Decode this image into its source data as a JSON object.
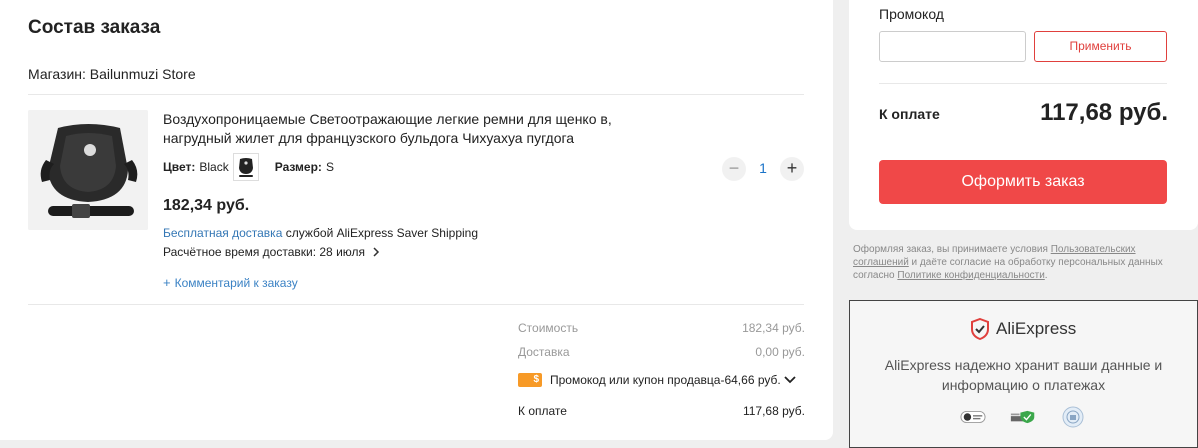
{
  "order": {
    "title": "Состав заказа",
    "store": "Магазин: Bailunmuzi Store",
    "product": {
      "title": "Воздухопроницаемые Светоотражающие легкие ремни для щенко в, нагрудный жилет для французского бульдога Чихуахуа пугдога",
      "color_label": "Цвет:",
      "color_value": "Black",
      "size_label": "Размер:",
      "size_value": "S",
      "quantity": "1",
      "price": "182,34 руб.",
      "shipping_link": "Бесплатная доставка",
      "shipping_text": "службой AliExpress Saver Shipping",
      "eta": "Расчётное время доставки: 28 июля",
      "comment": "Комментарий к заказу"
    },
    "summary": {
      "cost_label": "Стоимость",
      "cost_value": "182,34 руб.",
      "delivery_label": "Доставка",
      "delivery_value": "0,00 руб.",
      "coupon_text": "Промокод или купон продавца-64,66 руб.",
      "total_label": "К оплате",
      "total_value": "117,68 руб."
    }
  },
  "side": {
    "promo_label": "Промокод",
    "promo_value": "",
    "promo_button": "Применить",
    "pay_label": "К оплате",
    "pay_total": "117,68 руб.",
    "checkout_button": "Оформить заказ",
    "terms": {
      "part1": "Оформляя заказ, вы принимаете условия ",
      "link1": "Пользовательских соглашений",
      "part2": " и даёте согласие на обработку персональных данных согласно ",
      "link2": "Политике конфиденциальности",
      "part3": "."
    }
  },
  "secure": {
    "logo_text": "AliExpress",
    "text": "AliExpress надежно хранит ваши данные и информацию о платежах"
  },
  "colors": {
    "accent": "#f04848",
    "link": "#3477b5",
    "coupon": "#f79a27"
  }
}
